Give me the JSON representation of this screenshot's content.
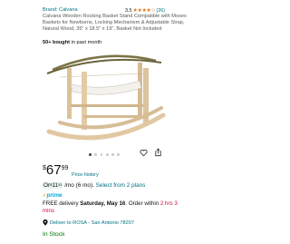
{
  "product": {
    "brand_link": "Brand: Calvana",
    "rating_value": "3.5",
    "rating_stars": "★★★★☆",
    "rating_count": "(26)",
    "title": "Calvana Wooden Rocking Basket Stand Compatible with Moses Baskets for Newborns, Locking Mechanism & Adjustable Strap, Natural Wood, 35\" x 18.5\" x 19\", Basket Not Included",
    "bought_bold": "50+ bought",
    "bought_rest": " in past month"
  },
  "carousel": {
    "total": 6,
    "active_index": 0
  },
  "actions": {
    "heart_icon": "heart-icon",
    "share_icon": "share-icon"
  },
  "price": {
    "currency": "$",
    "whole": "67",
    "fraction": "99",
    "history_link": "Price history"
  },
  "installments": {
    "prefix": "Or ",
    "currency": "$",
    "whole": "11",
    "fraction": "33",
    "per": " /mo (6 mo). ",
    "plans_link": "Select from 2 plans"
  },
  "prime": {
    "check": "✓",
    "label": "prime"
  },
  "delivery": {
    "prefix": "FREE delivery ",
    "date": "Saturday, May 16",
    "middle": ". Order within ",
    "countdown": "2 hrs 3 mins"
  },
  "location": {
    "label": "Deliver to ROSA - San Antonio 78207"
  },
  "stock": {
    "status": "In Stock"
  },
  "colors": {
    "link": "#007185",
    "star": "#de7921",
    "prime": "#00a8e1",
    "stock": "#007600",
    "urgent": "#cc0c39"
  }
}
